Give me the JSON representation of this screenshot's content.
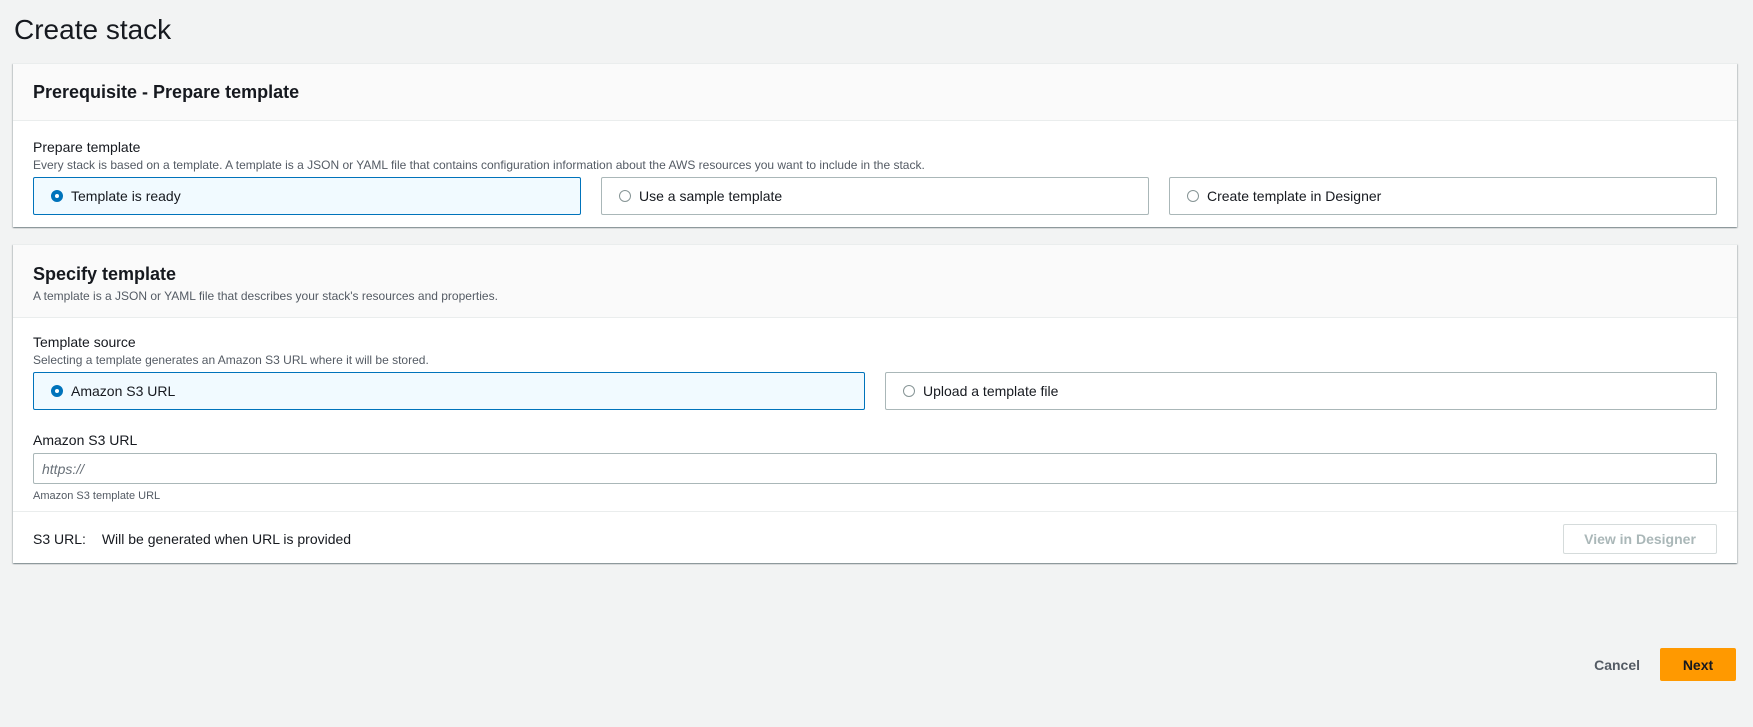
{
  "page": {
    "title": "Create stack"
  },
  "prerequisite": {
    "header": "Prerequisite - Prepare template",
    "field_label": "Prepare template",
    "field_desc": "Every stack is based on a template. A template is a JSON or YAML file that contains configuration information about the AWS resources you want to include in the stack.",
    "options": [
      {
        "label": "Template is ready",
        "selected": true
      },
      {
        "label": "Use a sample template",
        "selected": false
      },
      {
        "label": "Create template in Designer",
        "selected": false
      }
    ]
  },
  "specify": {
    "header": "Specify template",
    "header_desc": "A template is a JSON or YAML file that describes your stack's resources and properties.",
    "source_label": "Template source",
    "source_desc": "Selecting a template generates an Amazon S3 URL where it will be stored.",
    "options": [
      {
        "label": "Amazon S3 URL",
        "selected": true
      },
      {
        "label": "Upload a template file",
        "selected": false
      }
    ],
    "url_label": "Amazon S3 URL",
    "url_placeholder": "https://",
    "url_value": "",
    "url_hint": "Amazon S3 template URL",
    "s3_key": "S3 URL:",
    "s3_value": "Will be generated when URL is provided",
    "view_designer_label": "View in Designer"
  },
  "actions": {
    "cancel_label": "Cancel",
    "next_label": "Next"
  },
  "colors": {
    "accent": "#0073bb",
    "primary_button": "#ff9900",
    "background": "#f2f3f3"
  }
}
